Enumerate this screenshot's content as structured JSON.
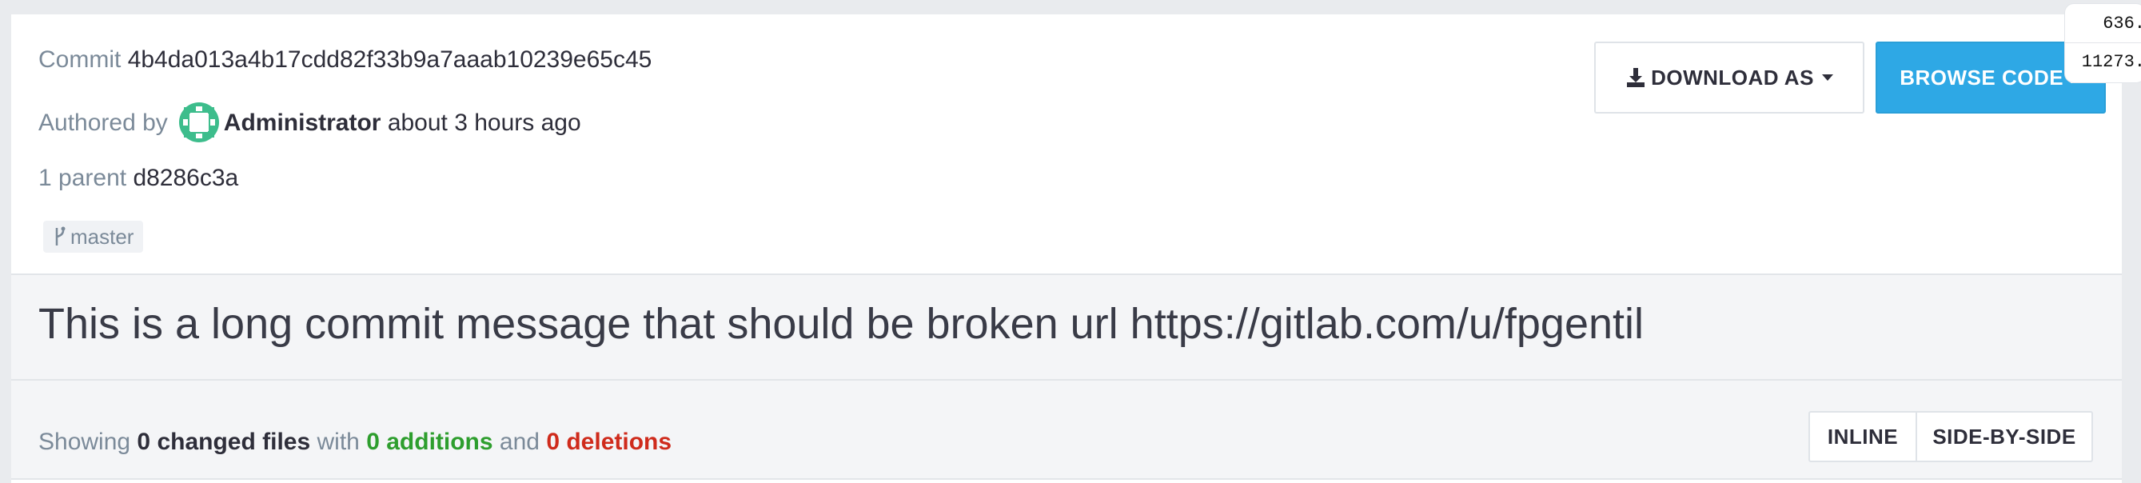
{
  "commit": {
    "label": "Commit",
    "sha": "4b4da013a4b17cdd82f33b9a7aaab10239e65c45",
    "authored_by_label": "Authored by",
    "author": "Administrator",
    "time": "about 3 hours ago",
    "parent_label": "1 parent",
    "parent_sha": "d8286c3a",
    "branch": "master",
    "message": "This is a long commit message that should be broken url https://gitlab.com/u/fpgentil"
  },
  "actions": {
    "download_label": "DOWNLOAD AS",
    "browse_label": "BROWSE CODE »"
  },
  "stats": {
    "showing_label": "Showing",
    "changed_files": "0 changed files",
    "with_label": "with",
    "additions": "0 additions",
    "and_label": "and",
    "deletions": "0 deletions"
  },
  "view_toggle": {
    "inline_label": "INLINE",
    "side_by_side_label": "SIDE-BY-SIDE"
  },
  "counter": {
    "top": "636.",
    "bottom": "11273."
  },
  "colors": {
    "accent": "#2ea8e5",
    "additions": "#2e9e2e",
    "deletions": "#cf2b1c",
    "avatar": "#3dbd8c"
  },
  "icons": {
    "download": "download-icon",
    "branch": "branch-icon",
    "avatar": "identicon-avatar"
  }
}
